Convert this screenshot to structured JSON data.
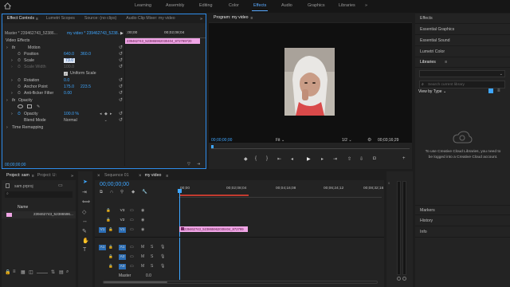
{
  "topnav": {
    "items": [
      "Learning",
      "Assembly",
      "Editing",
      "Color",
      "Effects",
      "Audio",
      "Graphics",
      "Libraries"
    ],
    "active_index": 4,
    "more": "»"
  },
  "effect_controls": {
    "tabs": [
      "Effect Controls",
      "Lumetri Scopes",
      "Source: (no clips)",
      "Audio Clip Mixer: my video"
    ],
    "menu_icon": "≡",
    "more": "»",
    "master_label": "Master * 239462743_52386...",
    "sequence_label": "my video * 239462743_5238...",
    "timecode_ruler_start": ";00;00",
    "timecode_ruler_mid": "00;02;08;04",
    "clip_name": "239462743_523865962030404_872799720",
    "section_video_effects": "Video Effects",
    "motion_label": "Motion",
    "position_label": "Position",
    "position_x": "640.0",
    "position_y": "360.0",
    "scale_label": "Scale",
    "scale_value": "73.0",
    "scale_width_label": "Scale Width",
    "scale_width_value": "100.0",
    "uniform_scale_label": "Uniform Scale",
    "rotation_label": "Rotation",
    "rotation_value": "0.0",
    "anchor_label": "Anchor Point",
    "anchor_x": "175.0",
    "anchor_y": "223.5",
    "antiflicker_label": "Anti-flicker Filter",
    "antiflicker_value": "0.00",
    "opacity_section": "Opacity",
    "opacity_label": "Opacity",
    "opacity_value": "100.0 %",
    "blend_label": "Blend Mode",
    "blend_value": "Normal",
    "time_remap_label": "Time Remapping",
    "bottom_timecode": "00;00;00;00"
  },
  "program": {
    "tab_label": "Program: my video",
    "menu_icon": "≡",
    "timecode": "00;00;00;00",
    "fit_label": "Fit",
    "fraction": "1/2",
    "duration": "00;03;16;29"
  },
  "right_panels": {
    "items": [
      "Effects",
      "Essential Graphics",
      "Essential Sound",
      "Lumetri Color"
    ],
    "libraries_title": "Libraries",
    "search_placeholder": "Search current library",
    "view_by": "View by Type",
    "cc_message": "To use Creative Cloud Libraries, you need to be logged into a Creative Cloud account.",
    "bottom_items": [
      "Markers",
      "History",
      "Info"
    ]
  },
  "project": {
    "tab_label": "Project: sam",
    "tab2_label": "Project: U:",
    "more": "»",
    "file_name": "sam.prproj",
    "column_name": "Name",
    "item_name": "239462743_52386596..."
  },
  "timeline": {
    "tabs": [
      "Sequence 01",
      "my video"
    ],
    "timecode": "00;00;00;00",
    "ruler_labels": [
      "00;00",
      "00;02;08;04",
      "00;04;16;08",
      "00;06;24;12",
      "00;08;32;16"
    ],
    "video_tracks": [
      "V3",
      "V2",
      "V1"
    ],
    "audio_tracks": [
      "A1",
      "A2",
      "A3"
    ],
    "source_v1": "V1",
    "source_a1": "A1",
    "master_label": "Master",
    "master_value": "0.0",
    "video_clip_name": "239462743_523865962030404_872799",
    "m_label": "M",
    "s_label": "S"
  },
  "colors": {
    "accent": "#2d8ceb",
    "clip_pink": "#f0a5e6",
    "clip_audio": "#3f8de0",
    "playhead": "#3ea6ff",
    "track_select": "#2c6eb5"
  }
}
